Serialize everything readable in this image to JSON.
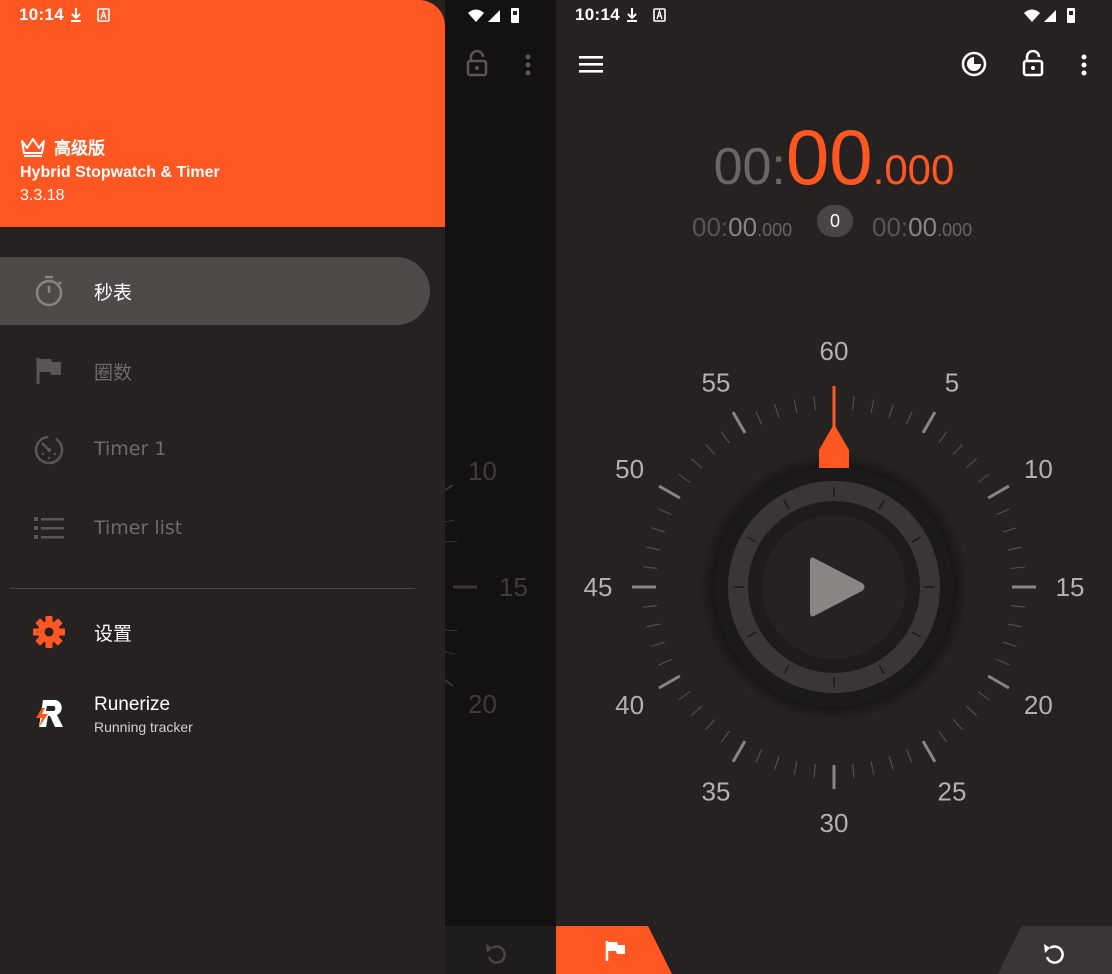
{
  "status": {
    "time": "10:14"
  },
  "drawer": {
    "premium_label": "高级版",
    "app_name": "Hybrid Stopwatch & Timer",
    "version": "3.3.18",
    "items": [
      {
        "label": "秒表",
        "icon": "stopwatch-icon",
        "active": true
      },
      {
        "label": "圈数",
        "icon": "flag-icon",
        "active": false
      },
      {
        "label": "Timer 1",
        "icon": "timer-icon",
        "active": false
      },
      {
        "label": "Timer list",
        "icon": "list-icon",
        "active": false
      }
    ],
    "settings_label": "设置",
    "promo": {
      "title": "Runerize",
      "subtitle": "Running tracker"
    }
  },
  "background_dial": {
    "labels": [
      "10",
      "15",
      "20"
    ]
  },
  "stopwatch": {
    "main": {
      "minutes": "00:",
      "seconds": "00",
      "dot": ".",
      "millis": "000"
    },
    "lap_left": {
      "minutes": "00:",
      "seconds": "00",
      "millis": ".000"
    },
    "lap_count": "0",
    "lap_right": {
      "minutes": "00:",
      "seconds": "00",
      "millis": ".000"
    },
    "dial_labels": [
      "60",
      "5",
      "10",
      "15",
      "20",
      "25",
      "30",
      "35",
      "40",
      "45",
      "50",
      "55"
    ]
  },
  "colors": {
    "accent": "#ff5722",
    "drawer_bg": "#262221",
    "active_item_bg": "#4f4a48"
  }
}
